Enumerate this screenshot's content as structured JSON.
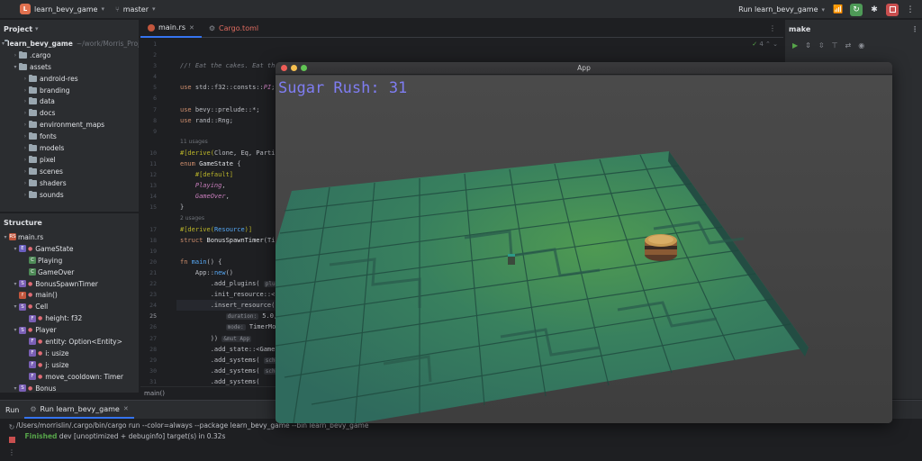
{
  "titlebar": {
    "project_badge": "L",
    "project_name": "learn_bevy_game",
    "branch": "master",
    "run_config": "Run learn_bevy_game"
  },
  "project_panel": {
    "title": "Project",
    "root": "learn_bevy_game",
    "root_path": "~/work/Morris_Proj",
    "items": [
      {
        "label": ".cargo",
        "depth": 1
      },
      {
        "label": "assets",
        "depth": 1,
        "open": true
      },
      {
        "label": "android-res",
        "depth": 2
      },
      {
        "label": "branding",
        "depth": 2
      },
      {
        "label": "data",
        "depth": 2
      },
      {
        "label": "docs",
        "depth": 2
      },
      {
        "label": "environment_maps",
        "depth": 2
      },
      {
        "label": "fonts",
        "depth": 2
      },
      {
        "label": "models",
        "depth": 2
      },
      {
        "label": "pixel",
        "depth": 2
      },
      {
        "label": "scenes",
        "depth": 2
      },
      {
        "label": "shaders",
        "depth": 2
      },
      {
        "label": "sounds",
        "depth": 2
      }
    ]
  },
  "structure_panel": {
    "title": "Structure",
    "items": [
      {
        "label": "main.rs",
        "depth": 0,
        "icon": "RS"
      },
      {
        "label": "GameState",
        "depth": 1,
        "icon": "E"
      },
      {
        "label": "Playing",
        "depth": 2,
        "icon": "C"
      },
      {
        "label": "GameOver",
        "depth": 2,
        "icon": "C"
      },
      {
        "label": "BonusSpawnTimer",
        "depth": 1,
        "icon": "S"
      },
      {
        "label": "main()",
        "depth": 1,
        "icon": "f"
      },
      {
        "label": "Cell",
        "depth": 1,
        "icon": "S"
      },
      {
        "label": "height: f32",
        "depth": 2,
        "icon": "F"
      },
      {
        "label": "Player",
        "depth": 1,
        "icon": "S"
      },
      {
        "label": "entity: Option<Entity>",
        "depth": 2,
        "icon": "F"
      },
      {
        "label": "i: usize",
        "depth": 2,
        "icon": "F"
      },
      {
        "label": "j: usize",
        "depth": 2,
        "icon": "F"
      },
      {
        "label": "move_cooldown: Timer",
        "depth": 2,
        "icon": "F"
      },
      {
        "label": "Bonus",
        "depth": 1,
        "icon": "S"
      }
    ]
  },
  "editor": {
    "tabs": [
      {
        "label": "main.rs",
        "active": true
      },
      {
        "label": "Cargo.toml",
        "active": false
      }
    ],
    "inspection_count": "4",
    "breadcrumb": "main()",
    "gutter": [
      "1",
      "2",
      "3",
      "4",
      "5",
      "6",
      "7",
      "8",
      "9",
      "",
      "10",
      "11",
      "12",
      "13",
      "14",
      "15",
      "",
      "17",
      "18",
      "19",
      "20",
      "21",
      "22",
      "23",
      "24",
      "25",
      "26",
      "27",
      "28",
      "29",
      "30",
      "31"
    ],
    "hints": {
      "usages_11": "11 usages",
      "usages_2": "2 usages"
    },
    "inlays": {
      "plugins": "plugin",
      "duration": "duration:",
      "mode": "mode:",
      "mutapp": "&mut App",
      "sched": "sche"
    }
  },
  "right_panel": {
    "title": "make"
  },
  "app_window": {
    "title": "App",
    "score_text": "Sugar Rush: 31"
  },
  "run_panel": {
    "label": "Run",
    "tab": "Run learn_bevy_game",
    "console_line1": "/Users/morrislin/.cargo/bin/cargo run --color=always --package learn_bevy_game --bin learn_bevy_game",
    "console_finished": "Finished",
    "console_line2_rest": " dev [unoptimized + debuginfo] target(s) in 0.32s"
  }
}
